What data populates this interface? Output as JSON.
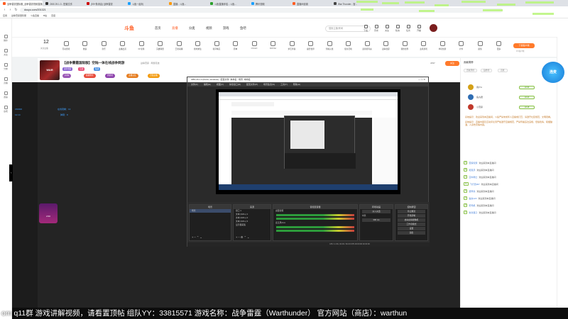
{
  "browser": {
    "tabs": [
      {
        "label": "战争雷霆国际服_战争雷霆视频直播 - 斗鱼",
        "color": "#ff5d23",
        "active": true
      },
      {
        "label": "OBS 29.1.3 - 配置文件",
        "color": "#333"
      },
      {
        "label": "(99+条消息) 战争雷霆",
        "color": "#c00"
      },
      {
        "label": "斗鱼一起玩",
        "color": "#1aa0ff"
      },
      {
        "label": "直播 - 斗鱼...",
        "color": "#ff9900"
      },
      {
        "label": "斗鱼直播伴侣 - 斗鱼...",
        "color": "#2ca02c"
      },
      {
        "label": "腾讯视频",
        "color": "#1aa0ff"
      },
      {
        "label": "直播间设置",
        "color": "#ff5d23"
      },
      {
        "label": "War Thunder - 官...",
        "color": "#444"
      }
    ],
    "url": "douyu.com/201321",
    "bookmarks": [
      "应用",
      "战争雷霆国际服",
      "斗鱼直播",
      "B站",
      "百度"
    ]
  },
  "left_sidebar": {
    "items": [
      "推荐",
      "关注",
      "分类",
      "直播",
      "赛事",
      "鱼吧"
    ]
  },
  "header": {
    "logo": "斗鱼",
    "nav": [
      "首页",
      "直播",
      "分类",
      "视频",
      "游戏",
      "鱼吧"
    ],
    "search_placeholder": "搜索主播/房间",
    "icons": [
      "下载",
      "历史",
      "关注",
      "私信",
      "任务",
      "开播"
    ]
  },
  "categories": {
    "count": "12",
    "count_label": "关注主播",
    "items": [
      "互动游戏",
      "舞蹈",
      "音乐",
      "主播出道",
      "FF专题",
      "英雄联盟",
      "王者荣耀",
      "绝地求生",
      "和平精英",
      "原神",
      "CS:GO",
      "DOTA2",
      "炉石传说",
      "魔兽世界",
      "穿越火线",
      "使命召唤",
      "逃离塔科夫",
      "战争雷霆",
      "我的世界",
      "主机游戏",
      "单机热游",
      "户外",
      "颜值",
      "更多"
    ],
    "pc_button": "下载客户端",
    "pc_sub": "PC客户端"
  },
  "room": {
    "thumb_text": "WAR THUNDER",
    "title": "【战争雷霆国际服】空陆一体在线战争网游",
    "category": "战争雷霆 · 网游竞技",
    "tags": [
      "战争雷霆",
      "空战",
      "陆战"
    ],
    "badges": [
      "LV99",
      "超级粉丝",
      "周星榜",
      "主播认证",
      "百强主播"
    ],
    "fans": "4767",
    "follow": "关注"
  },
  "player": {
    "left_ticker_1": "150000",
    "left_ticker_2": "12.14",
    "left_ticker_3": "在线观看：13",
    "left_ticker_4": "弹幕：8",
    "dragon_label": "2/10",
    "marquee": "om  q11群  游戏讲解视频，请看置顶帖  组队YY：33815571  游戏名称：战争雷霆（Warthunder）  官方网站（商店）：warthun"
  },
  "obs": {
    "title": "OBS 29.1.3 (64-bit, windows) - 配置文件: 未命名 - 场景: 未命名",
    "menu": [
      "文件(F)",
      "编辑(E)",
      "视图(V)",
      "停靠窗口(D)",
      "配置文件(P)",
      "场景集合(S)",
      "工具(T)",
      "帮助(H)"
    ],
    "docks": {
      "scenes": {
        "title": "场景",
        "items": [
          "场景"
        ]
      },
      "sources": {
        "title": "来源",
        "items": [
          "窗口 1",
          "文本 (GDI+) 1",
          "文本 (GDI+) 2",
          "文本 (GDI+) 3",
          "显示器采集"
        ]
      },
      "mixer": {
        "title": "音频混音器",
        "tracks": [
          "桌面音频",
          "麦克风/Aux"
        ],
        "levels": [
          "0.0 dB",
          "0.0 dB"
        ]
      },
      "transitions": {
        "title": "转场动画",
        "type": "淡入淡出",
        "duration_label": "时长",
        "duration": "300 ms"
      },
      "controls": {
        "title": "控制按钮",
        "buttons": [
          "停止推流",
          "开始录制",
          "启动虚拟摄像机",
          "工作室模式",
          "设置",
          "退出"
        ]
      }
    },
    "status": "CPU: 2.4%, 60.00 / 60.00 FPS    00:00:00    00:00:00"
  },
  "right_sidebar": {
    "rank_title": "贡献周榜",
    "tabs": [
      "贡献周榜",
      "钻粉榜",
      "贵族"
    ],
    "top_title": "守护排行",
    "ranks": [
      {
        "name": "用户A",
        "level": "LV.30",
        "color": "#d4a017"
      },
      {
        "name": "鱼丸君",
        "level": "LV.24",
        "color": "#2f6db3"
      },
      {
        "name": "小雷霆",
        "level": "LV.18",
        "color": "#c0392b"
      }
    ],
    "system_messages": [
      "系统提示：欢迎来到本直播间，斗鱼严禁未成年人直播或打赏，请遵守社区规范，文明观看。",
      "系统提示：直播内容及互动评论须严格遵守直播规范，严禁传播违法违规、低俗色情、吸烟酗酒、人身伤害等内容。"
    ],
    "chats": [
      {
        "level": "5",
        "nick": "雷霆玩家",
        "text": "欢迎来到本直播间"
      },
      {
        "level": "8",
        "nick": "坦克手",
        "text": "欢迎来到本直播间"
      },
      {
        "level": "3",
        "nick": "空中骑士",
        "text": "欢迎来到本直播间"
      },
      {
        "level": "11",
        "nick": "飞行员007",
        "text": "欢迎来到本直播间"
      },
      {
        "level": "6",
        "nick": "装甲兵",
        "text": "欢迎来到本直播间"
      },
      {
        "level": "2",
        "nick": "鱼友123",
        "text": "欢迎来到本直播间"
      },
      {
        "level": "9",
        "nick": "老司机",
        "text": "欢迎来到本直播间"
      },
      {
        "level": "4",
        "nick": "新兵蛋子",
        "text": "欢迎来到本直播间"
      }
    ],
    "badge_text": "连麦"
  }
}
